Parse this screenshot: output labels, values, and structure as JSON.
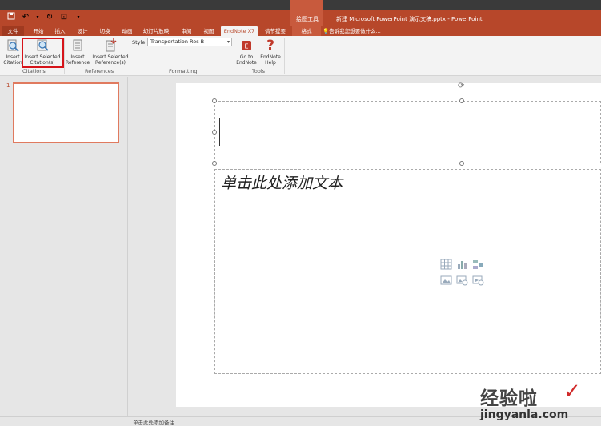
{
  "window": {
    "title": "新建 Microsoft PowerPoint 演示文稿.pptx - PowerPoint",
    "contextual_group_label": "绘图工具"
  },
  "qat": {
    "save_icon": "save-icon",
    "undo_icon": "undo-icon",
    "redo_icon": "redo-icon",
    "start_icon": "presentation-start-icon",
    "customize_icon": "customize-dropdown-icon"
  },
  "tabs": [
    {
      "label": "文件"
    },
    {
      "label": "开始"
    },
    {
      "label": "插入"
    },
    {
      "label": "设计"
    },
    {
      "label": "切换"
    },
    {
      "label": "动画"
    },
    {
      "label": "幻灯片放映"
    },
    {
      "label": "审阅"
    },
    {
      "label": "视图"
    },
    {
      "label": "EndNote X7"
    },
    {
      "label": "情节提要"
    },
    {
      "label": "格式"
    }
  ],
  "tellme": "告诉我您想要做什么...",
  "ribbon": {
    "insert_citation": "Insert Citation",
    "insert_selected_citations_line1": "Insert Selected",
    "insert_selected_citations_line2": "Citation(s)",
    "insert_reference_line1": "Insert",
    "insert_reference_line2": "Reference",
    "insert_selected_refs_line1": "Insert Selected",
    "insert_selected_refs_line2": "Reference(s)",
    "style_label": "Style:",
    "style_value": "Transportation Res B",
    "go_to_endnote_line1": "Go to",
    "go_to_endnote_line2": "EndNote",
    "endnote_help_line1": "EndNote",
    "endnote_help_line2": "Help",
    "groups": {
      "citations": "Citations",
      "references": "References",
      "formatting": "Formatting",
      "tools": "Tools"
    }
  },
  "slides": {
    "current_number": "1"
  },
  "slide": {
    "body_placeholder": "单击此处添加文本"
  },
  "notes": {
    "placeholder": "单击此处添加备注"
  },
  "watermark": {
    "brand": "经验啦",
    "url": "jingyanla.com"
  },
  "colors": {
    "accent": "#b7472a",
    "highlight_box": "#d6141a"
  }
}
